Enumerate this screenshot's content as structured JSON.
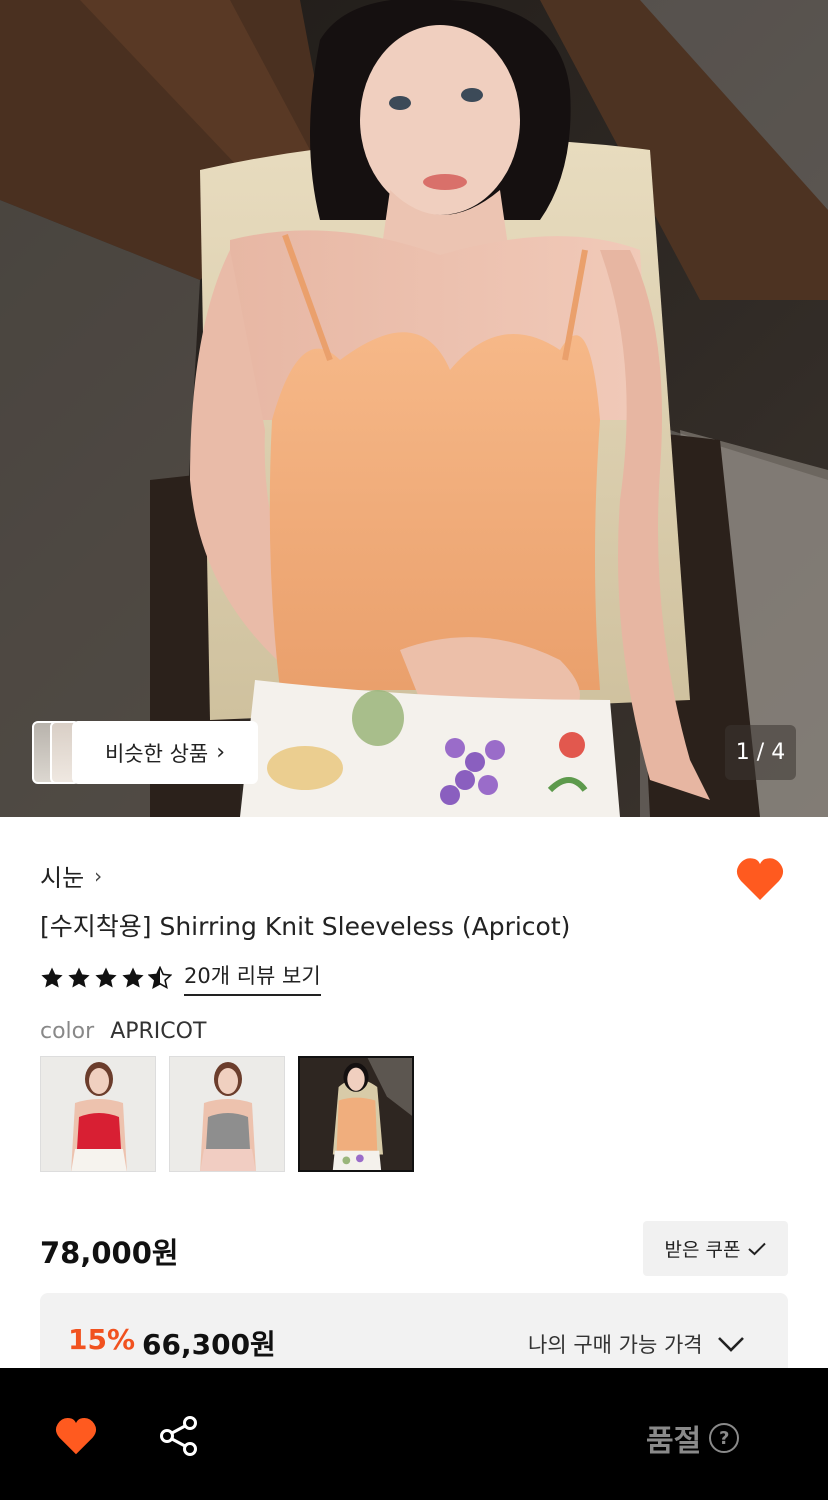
{
  "hero": {
    "similar_label": "비슷한 상품",
    "similar_chevron": "›",
    "counter": "1 / 4"
  },
  "product": {
    "brand": "시눈",
    "brand_chevron": "›",
    "title": "[수지착용] Shirring Knit Sleeveless (Apricot)",
    "rating": 4.5,
    "review_link": "20개 리뷰 보기",
    "color_label": "color",
    "color_value": "APRICOT",
    "swatches": [
      "red",
      "gray",
      "apricot"
    ],
    "selected_swatch": "apricot",
    "price": "78,000원",
    "coupon_label": "받은 쿠폰",
    "discount_rate": "15%",
    "discount_price": "66,300원",
    "my_price_label": "나의 구매 가능 가격"
  },
  "bottom_bar": {
    "heart_icon": "heart-icon",
    "share_icon": "share-icon",
    "soldout_label": "품절",
    "help_icon": "?"
  },
  "colors": {
    "accent": "#f1521f",
    "heart": "#ff5a1f",
    "bottom_bar": "#000000",
    "soldout_text": "#8a8a8a"
  }
}
